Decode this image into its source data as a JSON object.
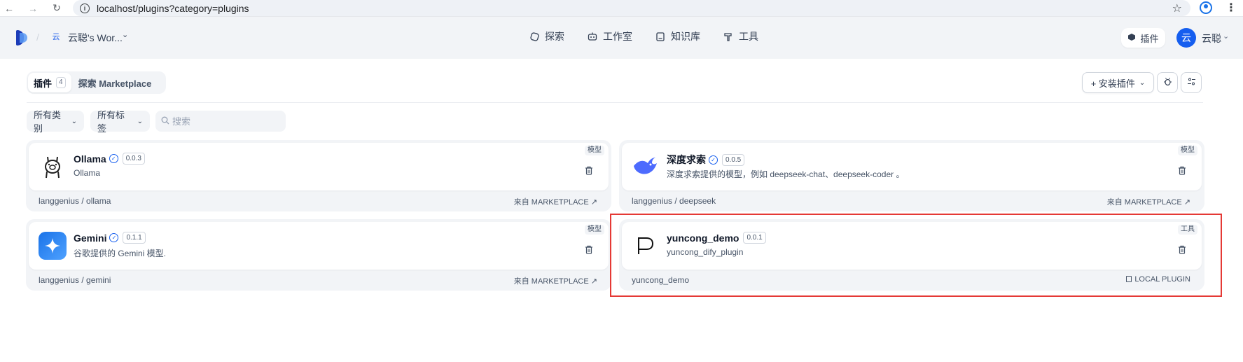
{
  "browser": {
    "url": "localhost/plugins?category=plugins"
  },
  "header": {
    "workspace_badge": "云",
    "workspace_name": "云聪's Wor...",
    "nav": [
      {
        "label": "探索",
        "icon": "compass-icon"
      },
      {
        "label": "工作室",
        "icon": "robot-icon"
      },
      {
        "label": "知识库",
        "icon": "book-icon"
      },
      {
        "label": "工具",
        "icon": "hammer-icon"
      }
    ],
    "plugin_button": "插件",
    "avatar_initial": "云",
    "user_name": "云聪"
  },
  "tabs": {
    "plugins_label": "插件",
    "plugins_count": "4",
    "marketplace_label": "探索 Marketplace"
  },
  "toolbar": {
    "install_label": "+ 安装插件"
  },
  "filters": {
    "category_label": "所有类别",
    "tag_label": "所有标签",
    "search_placeholder": "搜索"
  },
  "plugins": [
    {
      "name": "Ollama",
      "version": "0.0.3",
      "desc": "Ollama",
      "tag": "模型",
      "author": "langgenius / ollama",
      "source": "来自 MARKETPLACE ↗"
    },
    {
      "name": "深度求索",
      "version": "0.0.5",
      "desc": "深度求索提供的模型，例如 deepseek-chat、deepseek-coder 。",
      "tag": "模型",
      "author": "langgenius / deepseek",
      "source": "来自 MARKETPLACE ↗"
    },
    {
      "name": "Gemini",
      "version": "0.1.1",
      "desc": "谷歌提供的 Gemini 模型.",
      "tag": "模型",
      "author": "langgenius / gemini",
      "source": "来自 MARKETPLACE ↗"
    },
    {
      "name": "yuncong_demo",
      "version": "0.0.1",
      "desc": "yuncong_dify_plugin",
      "tag": "工具",
      "author": "yuncong_demo",
      "source": "LOCAL PLUGIN"
    }
  ],
  "colors": {
    "accent": "#155eef",
    "highlight": "#e53935"
  }
}
